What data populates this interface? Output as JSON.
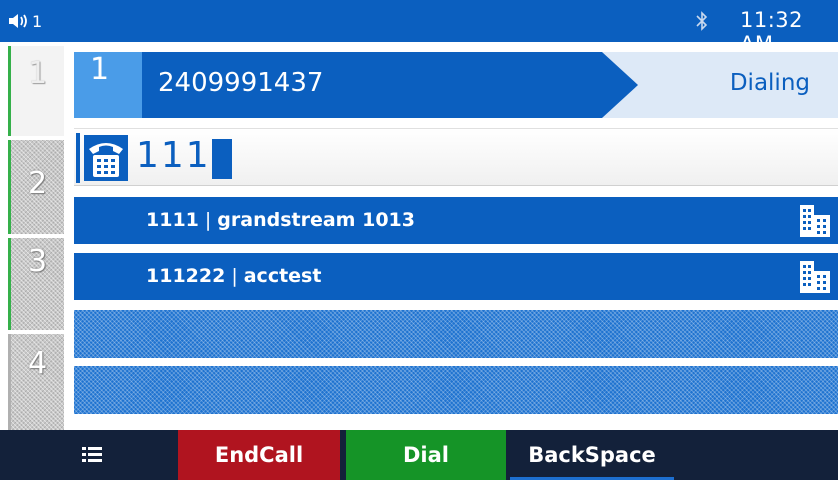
{
  "status_bar": {
    "volume_icon": "speaker-volume-icon",
    "account_index": "1",
    "bluetooth_icon": "bluetooth-icon",
    "time": "11:32 AM"
  },
  "line_keys": [
    {
      "label": "1",
      "state": "active"
    },
    {
      "label": "2",
      "state": "idle"
    },
    {
      "label": "3",
      "state": "idle"
    },
    {
      "label": "4",
      "state": "idle"
    }
  ],
  "call": {
    "line": "1",
    "number": "2409991437",
    "status": "Dialing"
  },
  "input": {
    "icon": "phone-icon",
    "typed": "111"
  },
  "suggestions": [
    {
      "number": "1111",
      "separator": "|",
      "name": "grandstream 1013",
      "icon": "company-contact-icon"
    },
    {
      "number": "111222",
      "separator": "|",
      "name": "acctest",
      "icon": "company-contact-icon"
    }
  ],
  "softkeys": {
    "menu_icon": "menu-list-icon",
    "endcall": "EndCall",
    "dial": "Dial",
    "backspace": "BackSpace"
  },
  "colors": {
    "primary_blue": "#0b5fbf",
    "endcall_red": "#b0141f",
    "dial_green": "#159427",
    "softkey_bar": "#13213a"
  }
}
